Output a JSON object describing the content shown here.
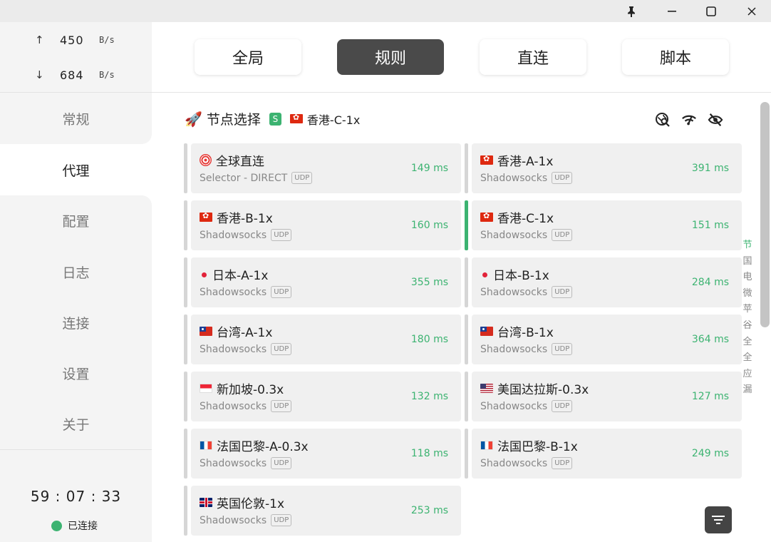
{
  "traffic": {
    "up_arrow": "↑",
    "up_value": "450",
    "up_unit": "B/s",
    "down_arrow": "↓",
    "down_value": "684",
    "down_unit": "B/s"
  },
  "nav": {
    "items": [
      {
        "label": "常规"
      },
      {
        "label": "代理"
      },
      {
        "label": "配置"
      },
      {
        "label": "日志"
      },
      {
        "label": "连接"
      },
      {
        "label": "设置"
      },
      {
        "label": "关于"
      }
    ],
    "active_index": 1
  },
  "footer": {
    "uptime": "59 : 07 : 33",
    "status": "已连接",
    "status_color": "#3cb371"
  },
  "modes": {
    "items": [
      {
        "label": "全局"
      },
      {
        "label": "规则"
      },
      {
        "label": "直连"
      },
      {
        "label": "脚本"
      }
    ],
    "active_index": 1
  },
  "group": {
    "icon": "🚀",
    "title": "节点选择",
    "badge": "S",
    "current_flag": "hk",
    "current": "香港-C-1x"
  },
  "header_icons": [
    "location-search-icon",
    "wifi-speed-icon",
    "eye-off-icon"
  ],
  "proxies": [
    {
      "name": "全球直连",
      "flag": "target",
      "type": "Selector - DIRECT",
      "udp": "UDP",
      "delay": "149 ms",
      "selected": false
    },
    {
      "name": "香港-A-1x",
      "flag": "hk",
      "type": "Shadowsocks",
      "udp": "UDP",
      "delay": "391 ms",
      "selected": false
    },
    {
      "name": "香港-B-1x",
      "flag": "hk",
      "type": "Shadowsocks",
      "udp": "UDP",
      "delay": "160 ms",
      "selected": false
    },
    {
      "name": "香港-C-1x",
      "flag": "hk",
      "type": "Shadowsocks",
      "udp": "UDP",
      "delay": "151 ms",
      "selected": true
    },
    {
      "name": "日本-A-1x",
      "flag": "jp",
      "type": "Shadowsocks",
      "udp": "UDP",
      "delay": "355 ms",
      "selected": false
    },
    {
      "name": "日本-B-1x",
      "flag": "jp",
      "type": "Shadowsocks",
      "udp": "UDP",
      "delay": "284 ms",
      "selected": false
    },
    {
      "name": "台湾-A-1x",
      "flag": "tw",
      "type": "Shadowsocks",
      "udp": "UDP",
      "delay": "180 ms",
      "selected": false
    },
    {
      "name": "台湾-B-1x",
      "flag": "tw",
      "type": "Shadowsocks",
      "udp": "UDP",
      "delay": "364 ms",
      "selected": false
    },
    {
      "name": "新加坡-0.3x",
      "flag": "sg",
      "type": "Shadowsocks",
      "udp": "UDP",
      "delay": "132 ms",
      "selected": false
    },
    {
      "name": "美国达拉斯-0.3x",
      "flag": "us",
      "type": "Shadowsocks",
      "udp": "UDP",
      "delay": "127 ms",
      "selected": false
    },
    {
      "name": "法国巴黎-A-0.3x",
      "flag": "fr",
      "type": "Shadowsocks",
      "udp": "UDP",
      "delay": "118 ms",
      "selected": false
    },
    {
      "name": "法国巴黎-B-1x",
      "flag": "fr",
      "type": "Shadowsocks",
      "udp": "UDP",
      "delay": "249 ms",
      "selected": false
    },
    {
      "name": "英国伦敦-1x",
      "flag": "gb",
      "type": "Shadowsocks",
      "udp": "UDP",
      "delay": "253 ms",
      "selected": false
    }
  ],
  "letter_index": [
    "节",
    "国",
    "电",
    "微",
    "苹",
    "谷",
    "全",
    "全",
    "应",
    "漏"
  ],
  "letter_active_index": 0,
  "accent_color": "#3cb371"
}
